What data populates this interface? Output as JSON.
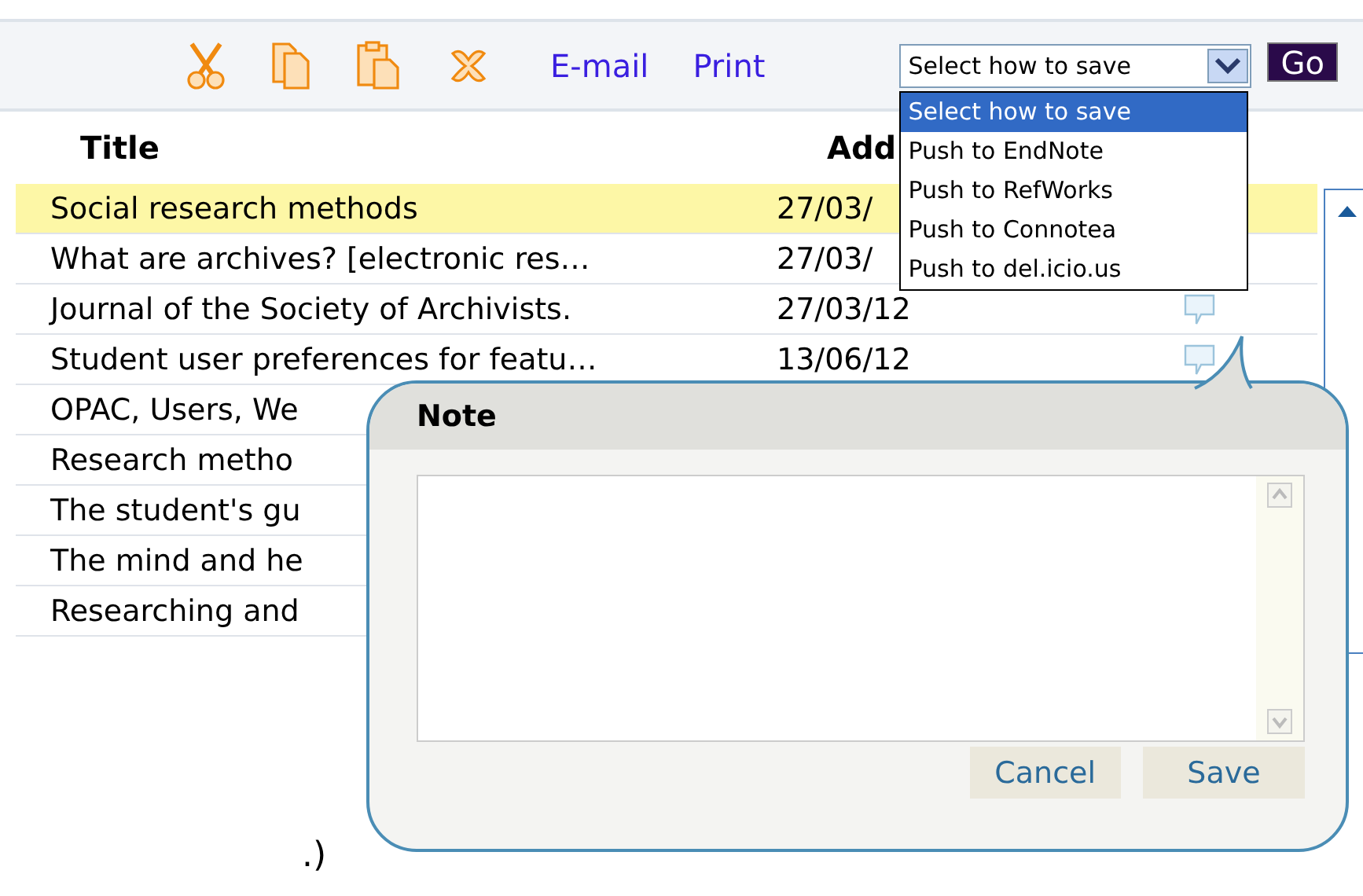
{
  "toolbar": {
    "links": [
      "E-mail",
      "Print"
    ],
    "save_select": {
      "value": "Select how to save",
      "expanded": true,
      "options": [
        {
          "label": "Select how to save",
          "selected": true
        },
        {
          "label": "Push to EndNote",
          "selected": false
        },
        {
          "label": "Push to RefWorks",
          "selected": false
        },
        {
          "label": "Push to Connotea",
          "selected": false
        },
        {
          "label": "Push to del.icio.us",
          "selected": false
        }
      ]
    },
    "go_button": "Go"
  },
  "table": {
    "columns": [
      "Title",
      "Add"
    ],
    "rows": [
      {
        "title": "Social research methods",
        "added": "27/03/",
        "selected": true,
        "has_note": false
      },
      {
        "title": "What are archives? [electronic res…",
        "added": "27/03/",
        "selected": false,
        "has_note": false
      },
      {
        "title": "Journal of the Society of Archivists.",
        "added": "27/03/12",
        "selected": false,
        "has_note": true
      },
      {
        "title": "Student user preferences for featu…",
        "added": "13/06/12",
        "selected": false,
        "has_note": true
      },
      {
        "title": "OPAC, Users, We",
        "added": "",
        "selected": false,
        "has_note": false
      },
      {
        "title": "Research metho",
        "added": "",
        "selected": false,
        "has_note": false
      },
      {
        "title": "The student's gu",
        "added": "",
        "selected": false,
        "has_note": false
      },
      {
        "title": "The mind and he",
        "added": "",
        "selected": false,
        "has_note": false
      },
      {
        "title": "Researching and",
        "added": "",
        "selected": false,
        "has_note": false
      }
    ]
  },
  "note_dialog": {
    "title": "Note",
    "buttons": [
      "Cancel",
      "Save"
    ]
  },
  "footer_text": ".)"
}
